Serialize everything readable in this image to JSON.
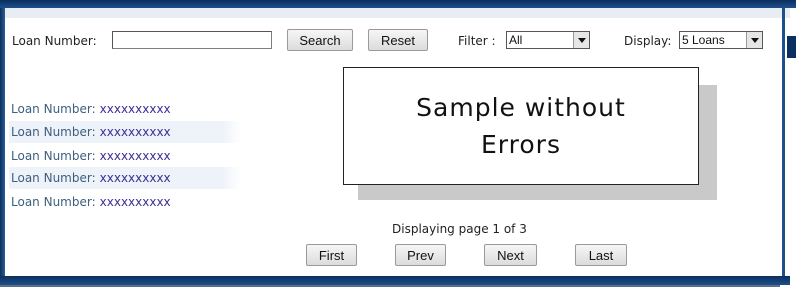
{
  "search": {
    "loan_label": "Loan Number:",
    "loan_value": "",
    "search_label": "Search",
    "reset_label": "Reset",
    "filter_label": "Filter :",
    "filter_value": "All",
    "display_label": "Display:",
    "display_value": "5 Loans"
  },
  "loans": [
    {
      "key": "Loan Number:",
      "value": "xxxxxxxxxx"
    },
    {
      "key": "Loan Number:",
      "value": "xxxxxxxxxx"
    },
    {
      "key": "Loan Number:",
      "value": "xxxxxxxxxx"
    },
    {
      "key": "Loan Number:",
      "value": "xxxxxxxxxx"
    },
    {
      "key": "Loan Number:",
      "value": "xxxxxxxxxx"
    }
  ],
  "callout": {
    "line1": "Sample without",
    "line2": "Errors"
  },
  "paging": {
    "status": "Displaying page 1 of 3",
    "first": "First",
    "prev": "Prev",
    "next": "Next",
    "last": "Last"
  },
  "colors": {
    "frame": "#0b2f5e",
    "loan_key": "#3e5f7f",
    "loan_value": "#3a2f9a",
    "row_alt": "#eef2f9"
  },
  "icons": {
    "select_arrow": "chevron-down-icon"
  }
}
